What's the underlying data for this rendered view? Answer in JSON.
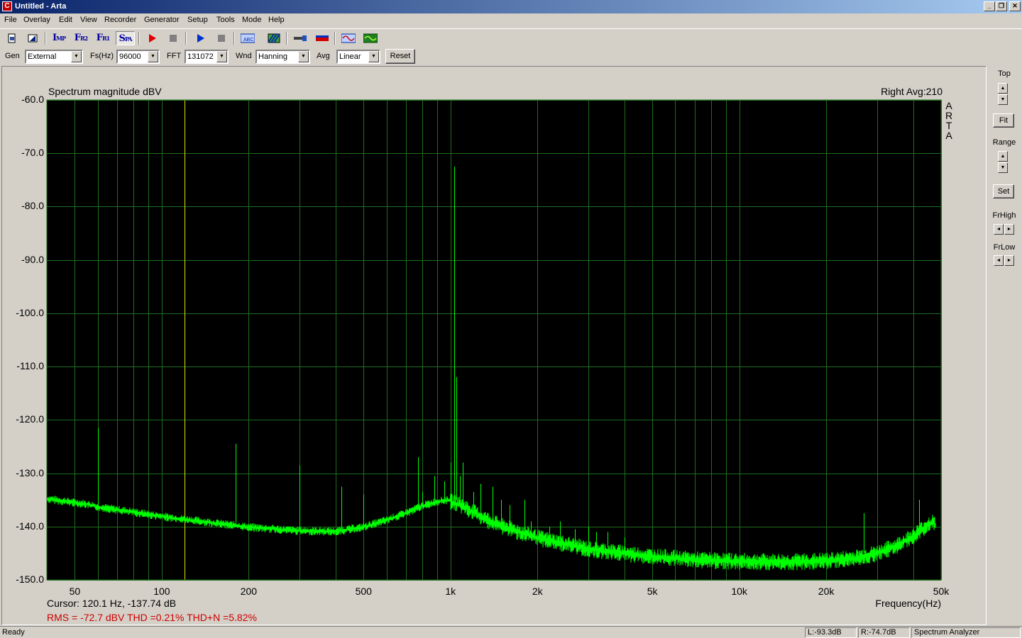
{
  "window": {
    "title": "Untitled - Arta",
    "app_icon": "arta-app-icon",
    "minimize": "_",
    "maximize": "❐",
    "close": "✕"
  },
  "menu": [
    "File",
    "Overlay",
    "Edit",
    "View",
    "Recorder",
    "Generator",
    "Setup",
    "Tools",
    "Mode",
    "Help"
  ],
  "toolbar": {
    "imp": {
      "big": "I",
      "small": "MP"
    },
    "fr2": {
      "big": "F",
      "small": "R2"
    },
    "fr1": {
      "big": "F",
      "small": "R1"
    },
    "spa": {
      "big": "S",
      "small": "PA"
    }
  },
  "settings": {
    "gen_label": "Gen",
    "gen_value": "External",
    "fs_label": "Fs(Hz)",
    "fs_value": "96000",
    "fft_label": "FFT",
    "fft_value": "131072",
    "wnd_label": "Wnd",
    "wnd_value": "Hanning",
    "avg_label": "Avg",
    "avg_value": "Linear",
    "reset_label": "Reset"
  },
  "plot": {
    "title": "Spectrum magnitude dBV",
    "status": "Right  Avg:210",
    "brand_vertical": [
      "A",
      "R",
      "T",
      "A"
    ],
    "xlabel": "Frequency(Hz)",
    "cursor_text": "Cursor:   120.1 Hz, -137.74 dB",
    "stats_text": "RMS =  -72.7 dBV   THD =0.21%   THD+N =5.82%"
  },
  "chart_data": {
    "type": "line",
    "x_scale": "log",
    "xlim": [
      40,
      50000
    ],
    "ylim": [
      -150,
      -60
    ],
    "ylabel": "Spectrum magnitude dBV",
    "xlabel": "Frequency(Hz)",
    "y_ticks": [
      "-60.0",
      "-70.0",
      "-80.0",
      "-90.0",
      "-100.0",
      "-110.0",
      "-120.0",
      "-130.0",
      "-140.0",
      "-150.0"
    ],
    "x_tick_labels": [
      {
        "f": 50,
        "label": "50"
      },
      {
        "f": 100,
        "label": "100"
      },
      {
        "f": 200,
        "label": "200"
      },
      {
        "f": 500,
        "label": "500"
      },
      {
        "f": 1000,
        "label": "1k"
      },
      {
        "f": 2000,
        "label": "2k"
      },
      {
        "f": 5000,
        "label": "5k"
      },
      {
        "f": 10000,
        "label": "10k"
      },
      {
        "f": 20000,
        "label": "20k"
      },
      {
        "f": 50000,
        "label": "50k"
      }
    ],
    "grid_minor_freqs": [
      60,
      70,
      80,
      90,
      300,
      400,
      600,
      700,
      800,
      900,
      3000,
      4000,
      6000,
      7000,
      8000,
      9000,
      30000,
      40000
    ],
    "grid": true,
    "background": "#000000",
    "grid_color": "#1e6e1e",
    "trace_color": "#00ff00",
    "cursor_color": "#e0e000",
    "cursor_freq": 120.1,
    "noise_floor": [
      [
        40,
        -134.5
      ],
      [
        55,
        -135.5
      ],
      [
        60,
        -136.0
      ],
      [
        80,
        -137.0
      ],
      [
        100,
        -137.8
      ],
      [
        150,
        -139.0
      ],
      [
        200,
        -139.8
      ],
      [
        300,
        -140.5
      ],
      [
        400,
        -140.6
      ],
      [
        500,
        -139.8
      ],
      [
        600,
        -138.5
      ],
      [
        700,
        -137.2
      ],
      [
        800,
        -135.8
      ],
      [
        900,
        -135.0
      ],
      [
        1000,
        -134.7
      ],
      [
        1100,
        -135.5
      ],
      [
        1300,
        -137.8
      ],
      [
        1500,
        -139.3
      ],
      [
        2000,
        -141.5
      ],
      [
        3000,
        -143.6
      ],
      [
        5000,
        -145.0
      ],
      [
        7000,
        -145.6
      ],
      [
        10000,
        -145.9
      ],
      [
        15000,
        -146.0
      ],
      [
        20000,
        -145.8
      ],
      [
        25000,
        -145.3
      ],
      [
        30000,
        -144.4
      ],
      [
        35000,
        -143.0
      ],
      [
        40000,
        -141.2
      ],
      [
        45000,
        -139.0
      ],
      [
        47000,
        -138.6
      ],
      [
        48000,
        -139.6
      ]
    ],
    "peaks": [
      [
        60,
        -121.5
      ],
      [
        180,
        -124.5
      ],
      [
        300,
        -128.5
      ],
      [
        420,
        -132.5
      ],
      [
        500,
        -134.0
      ],
      [
        770,
        -127.0
      ],
      [
        800,
        -133.5
      ],
      [
        880,
        -130.5
      ],
      [
        950,
        -131.5
      ],
      [
        1000,
        -128.0
      ],
      [
        1030,
        -72.5
      ],
      [
        1050,
        -112.0
      ],
      [
        1080,
        -130.5
      ],
      [
        1100,
        -128.0
      ],
      [
        1200,
        -133.5
      ],
      [
        1270,
        -132.0
      ],
      [
        1400,
        -132.5
      ],
      [
        1500,
        -135.0
      ],
      [
        1600,
        -136.0
      ],
      [
        1800,
        -135.0
      ],
      [
        1900,
        -139.0
      ],
      [
        2200,
        -140.0
      ],
      [
        2400,
        -139.0
      ],
      [
        2700,
        -140.5
      ],
      [
        3000,
        -140.0
      ],
      [
        3200,
        -141.0
      ],
      [
        3500,
        -141.0
      ],
      [
        4000,
        -142.0
      ],
      [
        27000,
        -137.5
      ],
      [
        42000,
        -135.0
      ]
    ]
  },
  "right_panel": {
    "top_label": "Top",
    "fit_label": "Fit",
    "range_label": "Range",
    "set_label": "Set",
    "frhigh_label": "FrHigh",
    "frlow_label": "FrLow"
  },
  "statusbar": {
    "ready": "Ready",
    "left_level": "L:-93.3dB",
    "right_level": "R:-74.7dB",
    "mode": "Spectrum Analyzer"
  }
}
